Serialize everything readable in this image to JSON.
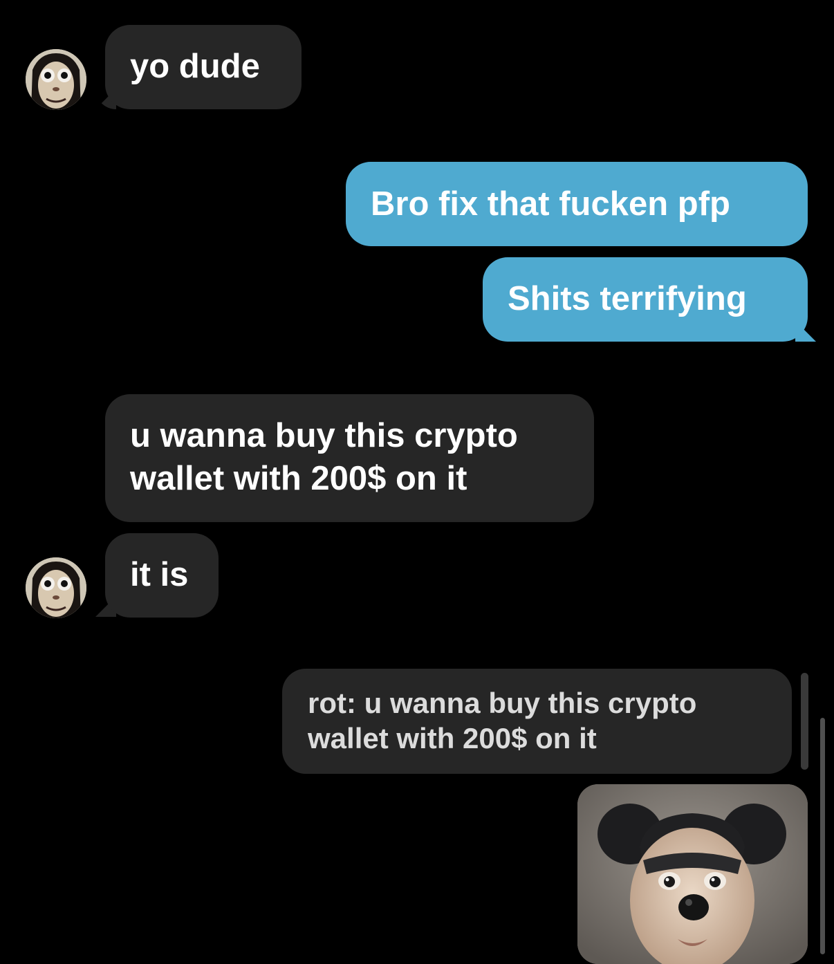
{
  "conversation": {
    "messages": [
      {
        "from": "them",
        "text": "yo dude"
      },
      {
        "from": "me",
        "text": "Bro fix that fucken pfp"
      },
      {
        "from": "me",
        "text": "Shits terrifying"
      },
      {
        "from": "them",
        "lines": [
          "u wanna buy this crypto",
          "wallet with 200$ on it"
        ]
      },
      {
        "from": "them",
        "text": "it is"
      }
    ],
    "reply_preview": {
      "lines": [
        "rot: u wanna buy this crypto",
        "wallet with 200$ on it"
      ]
    },
    "image_message": {
      "icon": "mouse-ears-photo"
    }
  },
  "avatars": {
    "icon": "creepy-face-avatar"
  },
  "colors": {
    "background": "#000000",
    "incoming_bubble": "#262626",
    "outgoing_bubble": "#4faad0",
    "text": "#ffffff"
  }
}
